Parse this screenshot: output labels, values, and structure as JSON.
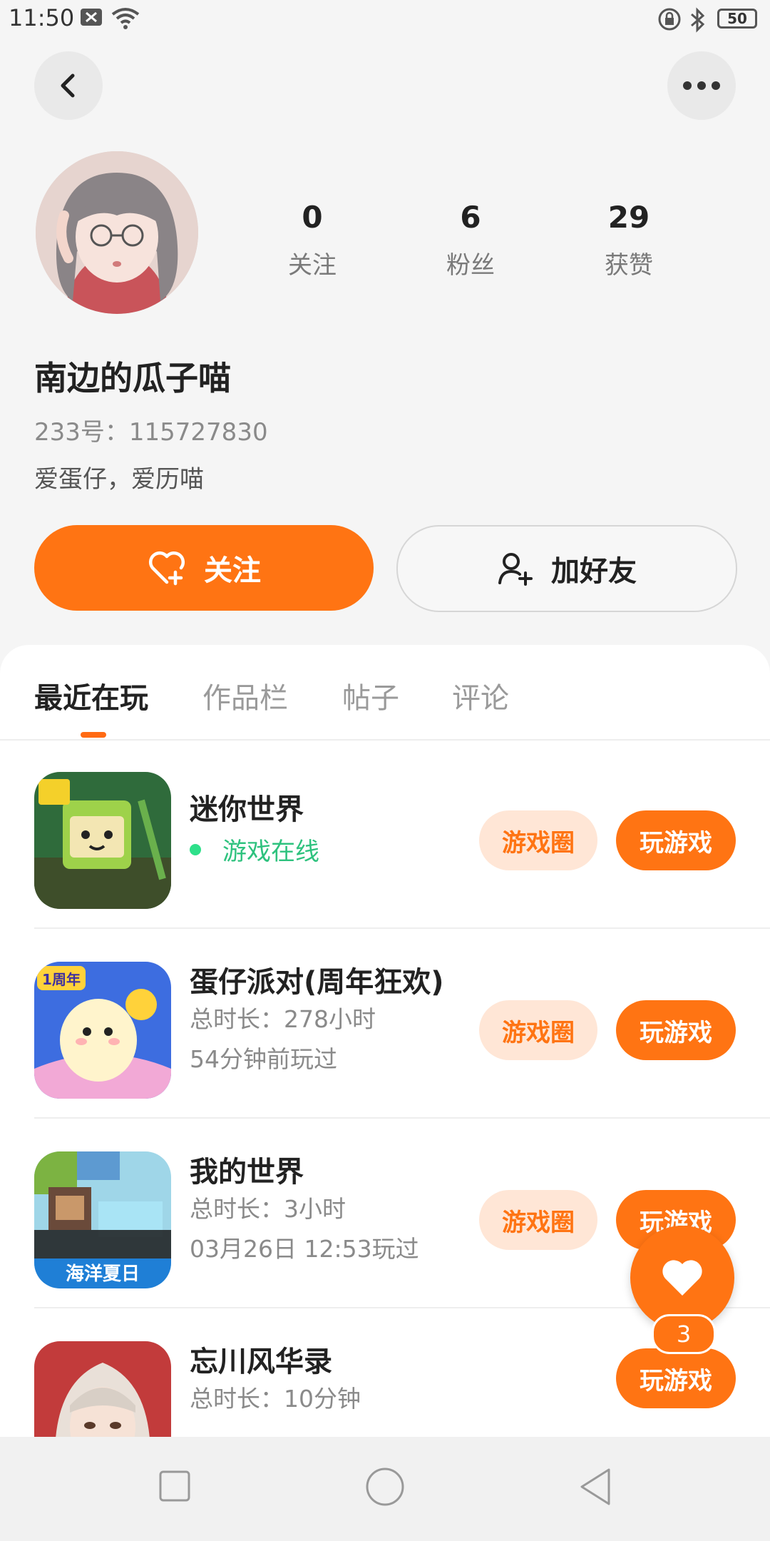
{
  "status_bar": {
    "time": "11:50",
    "battery": "50"
  },
  "profile": {
    "stats": [
      {
        "value": "0",
        "label": "关注"
      },
      {
        "value": "6",
        "label": "粉丝"
      },
      {
        "value": "29",
        "label": "获赞"
      }
    ],
    "name": "南边的瓜子喵",
    "uid": "233号：115727830",
    "bio": "爱蛋仔，爱历喵",
    "follow_label": "关注",
    "add_friend_label": "加好友"
  },
  "tabs": [
    "最近在玩",
    "作品栏",
    "帖子",
    "评论"
  ],
  "games": [
    {
      "title": "迷你世界",
      "online": "游戏在线",
      "circle_label": "游戏圈",
      "play_label": "玩游戏"
    },
    {
      "title": "蛋仔派对(周年狂欢)",
      "duration": "总时长：278小时",
      "last_played": "54分钟前玩过",
      "circle_label": "游戏圈",
      "play_label": "玩游戏"
    },
    {
      "title": "我的世界",
      "duration": "总时长：3小时",
      "last_played": "03月26日 12:53玩过",
      "circle_label": "游戏圈",
      "play_label": "玩游戏"
    },
    {
      "title": "忘川风华录",
      "duration": "总时长：10分钟",
      "play_label": "玩游戏"
    }
  ],
  "game_icon_text": {
    "mc_banner": "海洋夏日",
    "egg_badge": "1周年"
  },
  "like_count": "3",
  "colors": {
    "accent": "#ff7413",
    "online": "#2ec27e",
    "chip_bg": "#ffe6d6"
  }
}
